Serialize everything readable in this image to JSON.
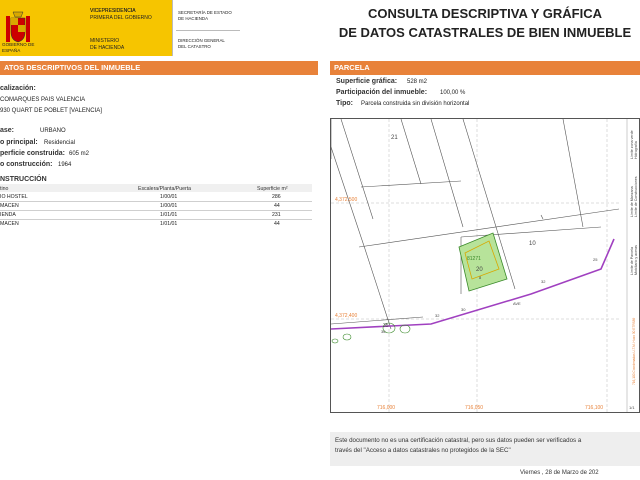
{
  "header": {
    "gobierno": "GOBIERNO\nDE ESPAÑA",
    "vicepresidencia_1": "VICEPRESIDENCIA",
    "vicepresidencia_2": "PRIMERA DEL GOBIERNO",
    "ministerio_1": "MINISTERIO",
    "ministerio_2": "DE HACIENDA",
    "secretaria_1": "SECRETARÍA DE ESTADO",
    "secretaria_2": "DE HACIENDA",
    "direccion_1": "DIRECCIÓN GENERAL",
    "direccion_2": "DEL CATASTRO",
    "title_1": "CONSULTA DESCRIPTIVA Y GRÁFICA",
    "title_2": "DE DATOS CATASTRALES DE BIEN INMUEBLE"
  },
  "left": {
    "section_title": "ATOS DESCRIPTIVOS DEL INMUEBLE",
    "localizacion_label": "calización:",
    "localizacion_1": "COMARQUES PAIS VALENCIA",
    "localizacion_2": "930 QUART DE POBLET [VALENCIA]",
    "clase_label": "ase:",
    "clase_value": "URBANO",
    "uso_label": "o principal:",
    "uso_value": "Residencial",
    "superficie_label": "perficie construida:",
    "superficie_value": "605 m2",
    "anio_label": "o construcción:",
    "anio_value": "1964",
    "construccion_label": "NSTRUCCIÓN",
    "table": {
      "headers": [
        "tino",
        "Escalera/Planta/Puerta",
        "Superficie m²"
      ],
      "rows": [
        [
          "IO HOSTEL",
          "1/00/01",
          "286"
        ],
        [
          "MACEN",
          "1/00/01",
          "44"
        ],
        [
          "IENDA",
          "1/01/01",
          "231"
        ],
        [
          "MACEN",
          "1/01/01",
          "44"
        ]
      ]
    }
  },
  "right": {
    "section_title": "PARCELA",
    "superficie_label": "Superficie gráfica:",
    "superficie_value": "528 m2",
    "participacion_label": "Participación del inmueble:",
    "participacion_value": "100,00 %",
    "tipo_label": "Tipo:",
    "tipo_value": "Parcela construida sin división horizontal"
  },
  "map": {
    "labels": {
      "parcel_21": "21",
      "parcel_10": "10",
      "parcel_20": "20",
      "parcel_35": "35",
      "parcel_30": "30",
      "parcel_25": "25",
      "parcel_32": "32",
      "parcel_32b": "32",
      "parcel_36": "36",
      "parcel_8": "8",
      "parcel_num": "81271",
      "road": "AVE",
      "utm_y1": "4,372,500",
      "utm_y2": "4,372,400",
      "utm_x1": "716,000",
      "utm_x2": "716,050",
      "utm_x3": "716,100"
    },
    "legend_vertical": [
      "Límite de Manzana",
      "Límite de Parcela",
      "Límite de Construcciones",
      "Mobiliario y aceras",
      "Límite zona verde",
      "Hidrografía",
      "716,100 Coordenadas U.T.M. Huso 30 ETRS89"
    ],
    "scale": "1/1"
  },
  "footer": {
    "line_1": "Este documento no es una certificación catastral, pero sus datos pueden ser verificados a",
    "line_2": "través del \"Acceso a datos catastrales no protegidos de la SEC\"",
    "date": "Viernes , 28 de Marzo de 202"
  },
  "colors": {
    "accent": "#e8823a",
    "flag_yellow": "#f6c500",
    "parcel_green": "#b7e39a",
    "boundary_purple": "#a040c0",
    "grid_gray": "#999999",
    "coord_orange": "#e8823a"
  }
}
